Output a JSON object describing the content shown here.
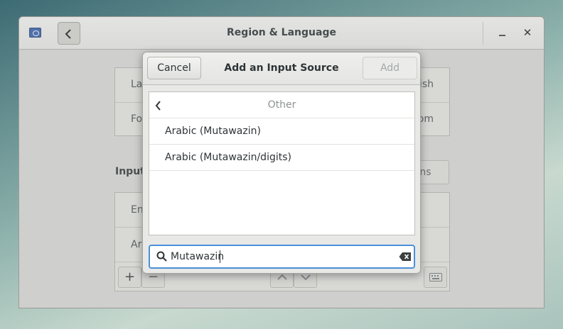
{
  "window": {
    "title": "Region & Language",
    "close_glyph": "✕"
  },
  "background": {
    "language_row": "Language",
    "formats_row": "Formats",
    "language_value": "English",
    "formats_value": "United Kingdom",
    "input_sources_heading": "Input Sources",
    "options_button": "Options",
    "input_rows": [
      "English",
      "Arabic"
    ],
    "add_glyph": "+",
    "remove_glyph": "−"
  },
  "dialog": {
    "title": "Add an Input Source",
    "cancel_label": "Cancel",
    "add_label": "Add",
    "list": {
      "header": "Other",
      "items": [
        "Arabic (Mutawazin)",
        "Arabic (Mutawazin/digits)"
      ]
    },
    "search": {
      "value": "Mutawazin"
    }
  },
  "colors": {
    "accent": "#4a90d9",
    "dialog_bg": "#e8e8e7",
    "window_bg": "#cfcfcd"
  }
}
